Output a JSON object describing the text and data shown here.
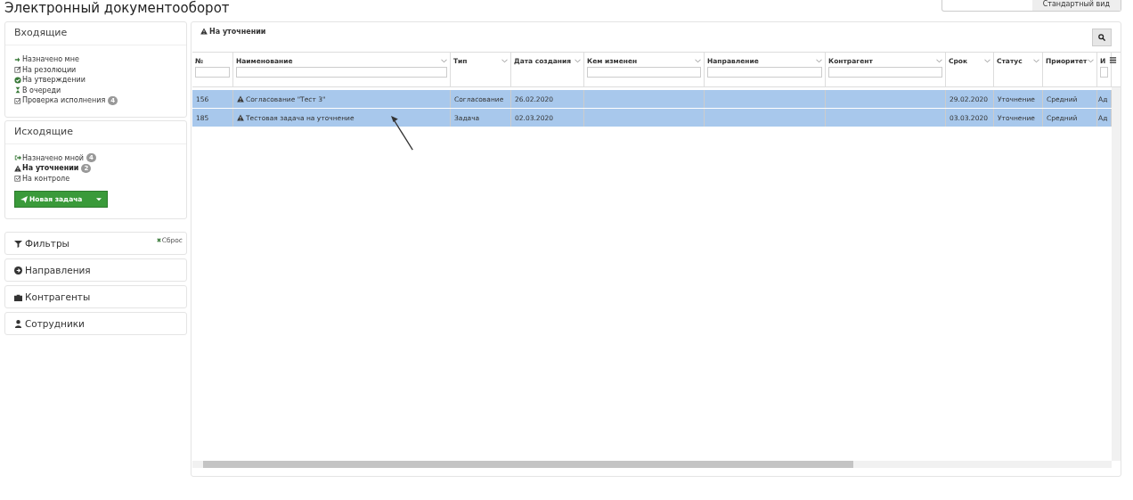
{
  "title": "Электронный документооборот",
  "view_button": "Стандартный вид",
  "incoming": {
    "title": "Входящие",
    "items": [
      {
        "label": "Назначено мне",
        "selected": false
      },
      {
        "label": "На резолюции",
        "selected": false
      },
      {
        "label": "На утверждении",
        "selected": false
      },
      {
        "label": "В очереди",
        "selected": false
      },
      {
        "label": "Проверка исполнения",
        "badge": "4",
        "selected": false
      }
    ]
  },
  "outgoing": {
    "title": "Исходящие",
    "items": [
      {
        "label": "Назначено мной",
        "badge": "4",
        "selected": false
      },
      {
        "label": "На уточнении",
        "badge": "2",
        "selected": true
      },
      {
        "label": "На контроле",
        "selected": false
      }
    ],
    "new_task": "Новая задача"
  },
  "panels": [
    {
      "label": "Фильтры",
      "reset": "Сброс"
    },
    {
      "label": "Направления"
    },
    {
      "label": "Контрагенты"
    },
    {
      "label": "Сотрудники"
    }
  ],
  "main": {
    "title": "На уточнении"
  },
  "table": {
    "columns": [
      {
        "label": "№",
        "filter": true,
        "sort": false
      },
      {
        "label": "Наименование",
        "filter": true,
        "sort": true
      },
      {
        "label": "Тип",
        "filter": false,
        "sort": true
      },
      {
        "label": "Дата создания",
        "filter": false,
        "sort": true
      },
      {
        "label": "Кем изменен",
        "filter": true,
        "sort": true
      },
      {
        "label": "Направление",
        "filter": true,
        "sort": true
      },
      {
        "label": "Контрагент",
        "filter": true,
        "sort": true
      },
      {
        "label": "Срок",
        "filter": false,
        "sort": true
      },
      {
        "label": "Статус",
        "filter": false,
        "sort": true
      },
      {
        "label": "Приоритет",
        "filter": false,
        "sort": true
      },
      {
        "label": "И",
        "filter": true,
        "sort": false
      }
    ],
    "rows": [
      {
        "selected": true,
        "cells": [
          "156",
          "Согласование \"Тест 3\"",
          "Согласование",
          "26.02.2020",
          "",
          "",
          "",
          "29.02.2020",
          "Уточнение",
          "Средний",
          "Ад"
        ]
      },
      {
        "selected": true,
        "cells": [
          "185",
          "Тестовая задача на уточнение",
          "Задача",
          "02.03.2020",
          "",
          "",
          "",
          "03.03.2020",
          "Уточнение",
          "Средний",
          "Ад"
        ]
      }
    ]
  }
}
